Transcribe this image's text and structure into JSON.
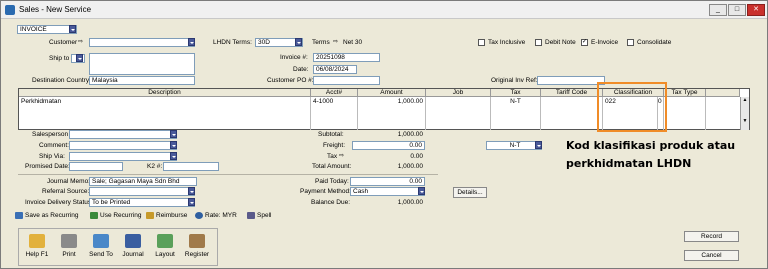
{
  "window": {
    "title": "Sales - New Service"
  },
  "header": {
    "form_type": "INVOICE",
    "customer_label": "Customer",
    "terms_label": "LHDN Terms:",
    "terms_value": "30D",
    "terms_text": "Terms",
    "terms_desc": "Net 30",
    "tax_inclusive": "Tax Inclusive",
    "debit_note": "Debit Note",
    "einvoice": "E-Invoice",
    "consolidate": "Consolidate",
    "ship_to_label": "Ship to",
    "invoice_no_label": "Invoice #:",
    "invoice_no": "20251098",
    "date_label": "Date:",
    "date": "06/08/2024",
    "customer_po_label": "Customer PO #:",
    "dest_country_label": "Destination Country:",
    "dest_country": "Malaysia",
    "orig_inv_ref_label": "Original Inv Ref:"
  },
  "grid": {
    "columns": [
      "Description",
      "Acct#",
      "Amount",
      "Job",
      "Tax",
      "Tariff Code",
      "Classification",
      "Tax Type"
    ],
    "rows": [
      {
        "description": "Perkhidmatan",
        "acct": "4-1000",
        "amount": "1,000.00",
        "job": "",
        "tax": "N-T",
        "tariff": "",
        "classification": "022",
        "extra": "0",
        "tax_type": ""
      }
    ]
  },
  "footer": {
    "salesperson_label": "Salesperson",
    "comment_label": "Comment:",
    "ship_via_label": "Ship Via:",
    "promised_date_label": "Promised Date:",
    "k2_label": "K2 #:",
    "subtotal_label": "Subtotal:",
    "subtotal": "1,000.00",
    "freight_label": "Freight:",
    "freight": "0.00",
    "freight_tax": "N-T",
    "tax_label": "Tax",
    "tax": "0.00",
    "total_label": "Total Amount:",
    "total": "1,000.00",
    "journal_memo_label": "Journal Memo:",
    "journal_memo": "Sale; Gagasan Maya Sdn Bhd",
    "referral_label": "Referral Source:",
    "delivery_label": "Invoice Delivery Status:",
    "delivery": "To be Printed",
    "paid_today_label": "Paid Today:",
    "paid_today": "0.00",
    "payment_method_label": "Payment Method:",
    "payment_method": "Cash",
    "details_button": "Details...",
    "balance_due_label": "Balance Due:",
    "balance_due": "1,000.00"
  },
  "toolstrip": {
    "save_recurring": "Save as Recurring",
    "use_recurring": "Use Recurring",
    "reimburse": "Reimburse",
    "rate": "Rate: MYR",
    "spell": "Spell"
  },
  "toolbar": {
    "help": "Help F1",
    "print": "Print",
    "send_to": "Send To",
    "journal": "Journal",
    "layout": "Layout",
    "register": "Register"
  },
  "actions": {
    "record": "Record",
    "cancel": "Cancel"
  },
  "annotation": {
    "line1": "Kod klasifikasi produk atau",
    "line2": "perkhidmatan LHDN"
  },
  "colors": {
    "highlight": "#f08c28",
    "icon_blue": "#4a5a9a"
  }
}
